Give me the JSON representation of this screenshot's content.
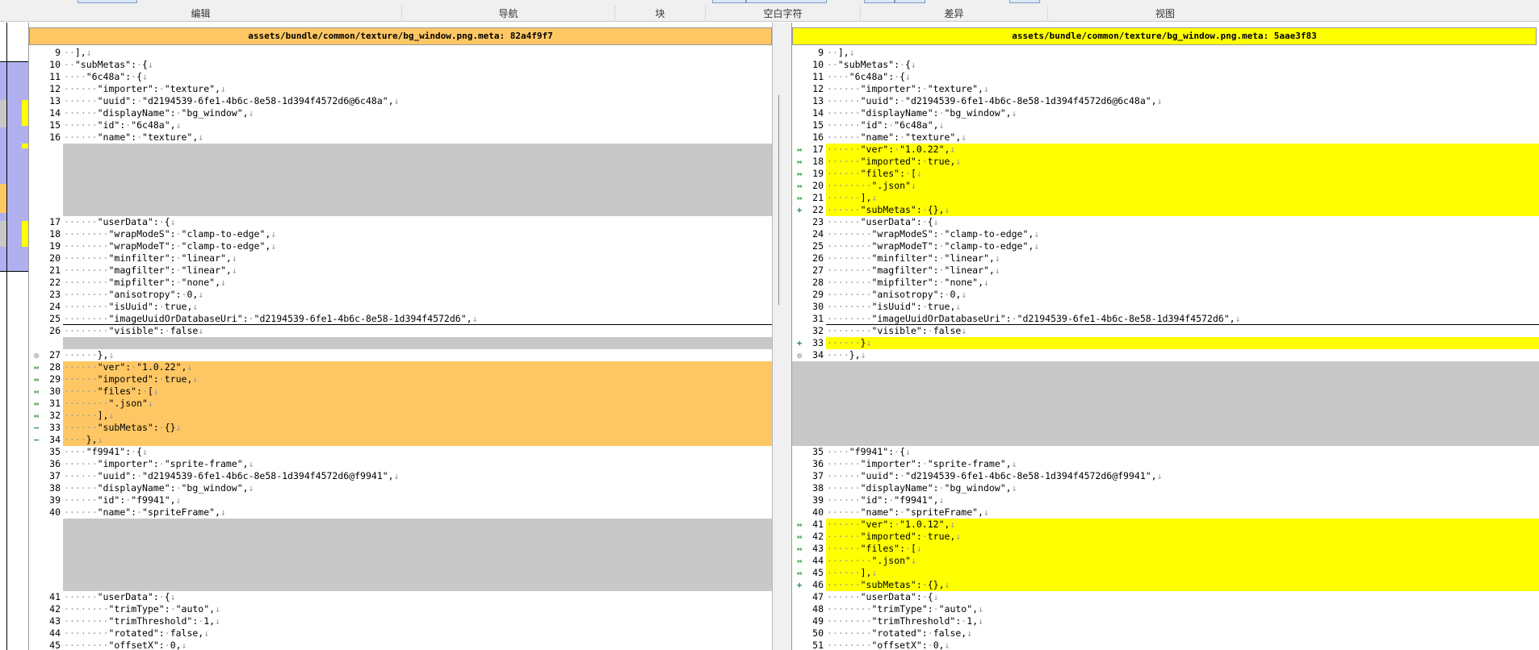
{
  "ribbon": {
    "groups": [
      "编辑",
      "导航",
      "块",
      "空白字符",
      "差异",
      "视图"
    ]
  },
  "left": {
    "header": "assets/bundle/common/texture/bg_window.png.meta: 82a4f9f7",
    "rows": [
      {
        "n": "9",
        "t": "··],↓"
      },
      {
        "n": "10",
        "t": "··\"subMetas\":·{↓"
      },
      {
        "n": "11",
        "t": "····\"6c48a\":·{↓"
      },
      {
        "n": "12",
        "t": "······\"importer\":·\"texture\",↓"
      },
      {
        "n": "13",
        "t": "······\"uuid\":·\"d2194539-6fe1-4b6c-8e58-1d394f4572d6@6c48a\",↓"
      },
      {
        "n": "14",
        "t": "······\"displayName\":·\"bg_window\",↓"
      },
      {
        "n": "15",
        "t": "······\"id\":·\"6c48a\",↓"
      },
      {
        "n": "16",
        "t": "······\"name\":·\"texture\",↓"
      },
      {
        "gap": 6,
        "inner": true
      },
      {
        "n": "17",
        "t": "······\"userData\":·{↓"
      },
      {
        "n": "18",
        "t": "········\"wrapModeS\":·\"clamp-to-edge\",↓"
      },
      {
        "n": "19",
        "t": "········\"wrapModeT\":·\"clamp-to-edge\",↓"
      },
      {
        "n": "20",
        "t": "········\"minfilter\":·\"linear\",↓"
      },
      {
        "n": "21",
        "t": "········\"magfilter\":·\"linear\",↓"
      },
      {
        "n": "22",
        "t": "········\"mipfilter\":·\"none\",↓"
      },
      {
        "n": "23",
        "t": "········\"anisotropy\":·0,↓"
      },
      {
        "n": "24",
        "t": "········\"isUuid\":·true,↓"
      },
      {
        "n": "25",
        "t": "········\"imageUuidOrDatabaseUri\":·\"d2194539-6fe1-4b6c-8e58-1d394f4572d6\",↓",
        "ul": true
      },
      {
        "n": "26",
        "t": "········\"visible\":·false↓"
      },
      {
        "gap": 1,
        "inner": true
      },
      {
        "n": "27",
        "t": "······},↓",
        "m": "dot"
      },
      {
        "n": "28",
        "t": "······\"ver\":·\"1.0.22\",↓",
        "m": "arr",
        "c": "or"
      },
      {
        "n": "29",
        "t": "······\"imported\":·true,↓",
        "m": "arr",
        "c": "or"
      },
      {
        "n": "30",
        "t": "······\"files\":·[↓",
        "m": "arr",
        "c": "or"
      },
      {
        "n": "31",
        "t": "········\".json\"↓",
        "m": "arr",
        "c": "or"
      },
      {
        "n": "32",
        "t": "······],↓",
        "m": "arr",
        "c": "or"
      },
      {
        "n": "33",
        "t": "······\"subMetas\":·{}↓",
        "m": "minus",
        "c": "or"
      },
      {
        "n": "34",
        "t": "····},↓",
        "m": "minus",
        "c": "or"
      },
      {
        "n": "35",
        "t": "····\"f9941\":·{↓"
      },
      {
        "n": "36",
        "t": "······\"importer\":·\"sprite-frame\",↓"
      },
      {
        "n": "37",
        "t": "······\"uuid\":·\"d2194539-6fe1-4b6c-8e58-1d394f4572d6@f9941\",↓"
      },
      {
        "n": "38",
        "t": "······\"displayName\":·\"bg_window\",↓"
      },
      {
        "n": "39",
        "t": "······\"id\":·\"f9941\",↓"
      },
      {
        "n": "40",
        "t": "······\"name\":·\"spriteFrame\",↓"
      },
      {
        "gap": 6,
        "inner": true
      },
      {
        "n": "41",
        "t": "······\"userData\":·{↓"
      },
      {
        "n": "42",
        "t": "········\"trimType\":·\"auto\",↓"
      },
      {
        "n": "43",
        "t": "········\"trimThreshold\":·1,↓"
      },
      {
        "n": "44",
        "t": "········\"rotated\":·false,↓"
      },
      {
        "n": "45",
        "t": "········\"offsetX\":·0,↓"
      }
    ]
  },
  "right": {
    "header": "assets/bundle/common/texture/bg_window.png.meta: 5aae3f83",
    "rows": [
      {
        "n": "9",
        "t": "··],↓"
      },
      {
        "n": "10",
        "t": "··\"subMetas\":·{↓"
      },
      {
        "n": "11",
        "t": "····\"6c48a\":·{↓"
      },
      {
        "n": "12",
        "t": "······\"importer\":·\"texture\",↓"
      },
      {
        "n": "13",
        "t": "······\"uuid\":·\"d2194539-6fe1-4b6c-8e58-1d394f4572d6@6c48a\",↓"
      },
      {
        "n": "14",
        "t": "······\"displayName\":·\"bg_window\",↓"
      },
      {
        "n": "15",
        "t": "······\"id\":·\"6c48a\",↓"
      },
      {
        "n": "16",
        "t": "······\"name\":·\"texture\",↓"
      },
      {
        "n": "17",
        "t": "······\"ver\":·\"1.0.22\",↓",
        "m": "arr",
        "c": "yl"
      },
      {
        "n": "18",
        "t": "······\"imported\":·true,↓",
        "m": "arr",
        "c": "yl"
      },
      {
        "n": "19",
        "t": "······\"files\":·[↓",
        "m": "arr",
        "c": "yl"
      },
      {
        "n": "20",
        "t": "········\".json\"↓",
        "m": "arr",
        "c": "yl"
      },
      {
        "n": "21",
        "t": "······],↓",
        "m": "arr",
        "c": "yl"
      },
      {
        "n": "22",
        "t": "······\"subMetas\":·{},↓",
        "m": "plus",
        "c": "yl"
      },
      {
        "n": "23",
        "t": "······\"userData\":·{↓"
      },
      {
        "n": "24",
        "t": "········\"wrapModeS\":·\"clamp-to-edge\",↓"
      },
      {
        "n": "25",
        "t": "········\"wrapModeT\":·\"clamp-to-edge\",↓"
      },
      {
        "n": "26",
        "t": "········\"minfilter\":·\"linear\",↓"
      },
      {
        "n": "27",
        "t": "········\"magfilter\":·\"linear\",↓"
      },
      {
        "n": "28",
        "t": "········\"mipfilter\":·\"none\",↓"
      },
      {
        "n": "29",
        "t": "········\"anisotropy\":·0,↓"
      },
      {
        "n": "30",
        "t": "········\"isUuid\":·true,↓"
      },
      {
        "n": "31",
        "t": "········\"imageUuidOrDatabaseUri\":·\"d2194539-6fe1-4b6c-8e58-1d394f4572d6\",↓",
        "ul": true
      },
      {
        "n": "32",
        "t": "········\"visible\":·false↓"
      },
      {
        "n": "33",
        "t": "······}↓",
        "m": "plus",
        "c": "yl"
      },
      {
        "n": "34",
        "t": "····},↓",
        "m": "dot"
      },
      {
        "gap": 7,
        "inner": false
      },
      {
        "n": "35",
        "t": "····\"f9941\":·{↓"
      },
      {
        "n": "36",
        "t": "······\"importer\":·\"sprite-frame\",↓"
      },
      {
        "n": "37",
        "t": "······\"uuid\":·\"d2194539-6fe1-4b6c-8e58-1d394f4572d6@f9941\",↓"
      },
      {
        "n": "38",
        "t": "······\"displayName\":·\"bg_window\",↓"
      },
      {
        "n": "39",
        "t": "······\"id\":·\"f9941\",↓"
      },
      {
        "n": "40",
        "t": "······\"name\":·\"spriteFrame\",↓"
      },
      {
        "n": "41",
        "t": "······\"ver\":·\"1.0.12\",↓",
        "m": "arr",
        "c": "yl"
      },
      {
        "n": "42",
        "t": "······\"imported\":·true,↓",
        "m": "arr",
        "c": "yl"
      },
      {
        "n": "43",
        "t": "······\"files\":·[↓",
        "m": "arr",
        "c": "yl"
      },
      {
        "n": "44",
        "t": "········\".json\"↓",
        "m": "arr",
        "c": "yl"
      },
      {
        "n": "45",
        "t": "······],↓",
        "m": "arr",
        "c": "yl"
      },
      {
        "n": "46",
        "t": "······\"subMetas\":·{},↓",
        "m": "plus",
        "c": "yl"
      },
      {
        "n": "47",
        "t": "······\"userData\":·{↓"
      },
      {
        "n": "48",
        "t": "········\"trimType\":·\"auto\",↓"
      },
      {
        "n": "49",
        "t": "········\"trimThreshold\":·1,↓"
      },
      {
        "n": "50",
        "t": "········\"rotated\":·false,↓"
      },
      {
        "n": "51",
        "t": "········\"offsetX\":·0,↓"
      }
    ]
  },
  "markers": {
    "arr": "⇔",
    "plus": "+",
    "minus": "−",
    "dot": "●"
  },
  "colors": {
    "left_changed": "#ffc764",
    "right_changed": "#ffff00",
    "filler": "#c8c8c8",
    "marker": "#3c9a3c"
  }
}
